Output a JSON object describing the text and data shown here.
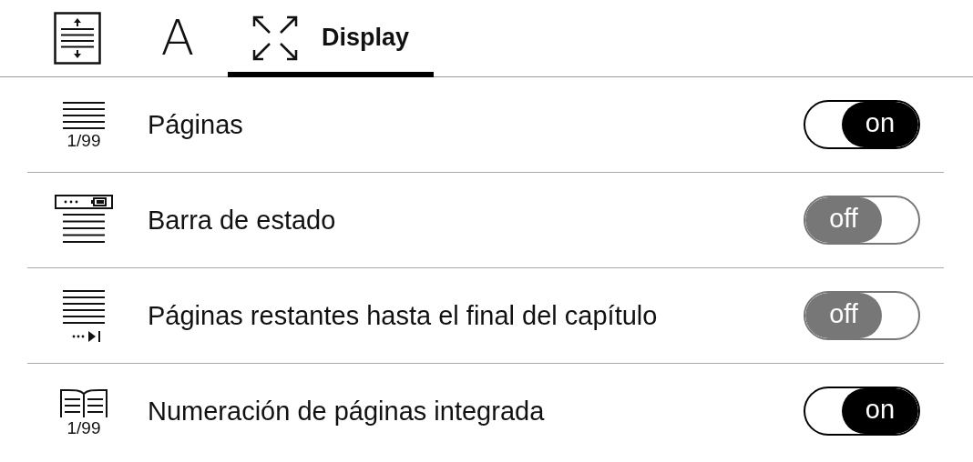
{
  "tabs": [
    {
      "kind": "layout",
      "selected": false
    },
    {
      "kind": "font",
      "glyph": "A",
      "selected": false
    },
    {
      "kind": "display",
      "label": "Display",
      "selected": true
    }
  ],
  "rows": [
    {
      "kind": "pages",
      "icon_caption": "1/99",
      "label": "Páginas",
      "on": true,
      "toggle_text": "on"
    },
    {
      "kind": "status_bar",
      "label": "Barra de estado",
      "on": false,
      "toggle_text": "off"
    },
    {
      "kind": "remaining",
      "label": "Páginas restantes hasta el final del capítulo",
      "on": false,
      "toggle_text": "off"
    },
    {
      "kind": "book",
      "icon_caption": "1/99",
      "label": "Numeración de páginas integrada",
      "on": true,
      "toggle_text": "on"
    }
  ]
}
